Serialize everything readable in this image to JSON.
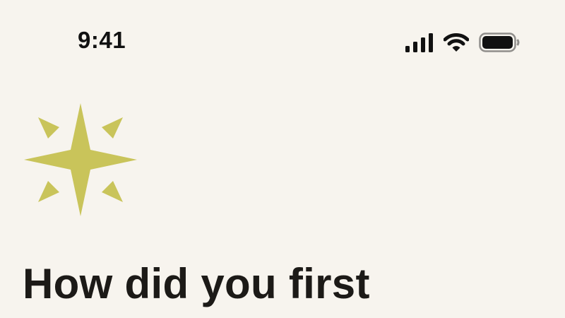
{
  "status_bar": {
    "time": "9:41",
    "signal_icon": "cellular-signal-icon",
    "wifi_icon": "wifi-icon",
    "battery_icon": "battery-icon",
    "battery_level": 1.0
  },
  "logo": {
    "icon": "sparkle-star-icon",
    "color": "#c9c45a"
  },
  "main": {
    "headline": "How did you first"
  },
  "colors": {
    "background": "#f7f4ee",
    "text": "#1c1a17"
  }
}
